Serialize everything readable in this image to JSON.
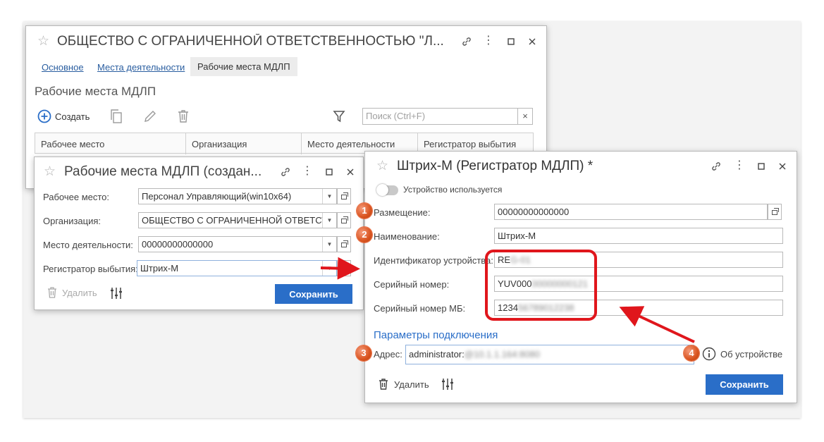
{
  "main_window": {
    "title": "ОБЩЕСТВО С ОГРАНИЧЕННОЙ ОТВЕТСТВЕННОСТЬЮ \"Л...",
    "tabs": [
      {
        "label": "Основное",
        "active": false
      },
      {
        "label": "Места деятельности",
        "active": false
      },
      {
        "label": "Рабочие места МДЛП",
        "active": true
      }
    ],
    "section_title": "Рабочие места МДЛП",
    "toolbar": {
      "create_label": "Создать",
      "search_placeholder": "Поиск (Ctrl+F)",
      "search_clear": "×"
    },
    "columns": [
      "Рабочее место",
      "Организация",
      "Место деятельности",
      "Регистратор выбытия"
    ]
  },
  "workplace_dialog": {
    "title": "Рабочие места МДЛП (создан...",
    "fields": [
      {
        "label": "Рабочее место:",
        "value": "Персонал Управляющий(win10x64)"
      },
      {
        "label": "Организация:",
        "value": "ОБЩЕСТВО С ОГРАНИЧЕННОЙ ОТВЕТСТВЕННОСТЬЮ"
      },
      {
        "label": "Место деятельности:",
        "value": "00000000000000"
      },
      {
        "label": "Регистратор выбытия:",
        "value": "Штрих-М"
      }
    ],
    "delete_label": "Удалить",
    "save_label": "Сохранить"
  },
  "registrar_dialog": {
    "title": "Штрих-М (Регистратор МДЛП) *",
    "toggle_label": "Устройство используется",
    "fields": [
      {
        "label": "Размещение:",
        "value": "00000000000000"
      },
      {
        "label": "Наименование:",
        "value": "Штрих-М"
      },
      {
        "label": "Идентификатор устройства:",
        "value_visible": "RE",
        "value_blurred": "G-01"
      },
      {
        "label": "Серийный номер:",
        "value_visible": "YUV000",
        "value_blurred": "00000000121"
      },
      {
        "label": "Серийный номер МБ:",
        "value_visible": "1234",
        "value_blurred": "56789012238"
      }
    ],
    "connection_section": "Параметры подключения",
    "address_label": "Адрес:",
    "address_visible": "administrator:",
    "address_blurred": "@10.1.1.164:8080",
    "about_label": "Об устройстве",
    "delete_label": "Удалить",
    "save_label": "Сохранить"
  },
  "badges": [
    "1",
    "2",
    "3",
    "4"
  ],
  "colors": {
    "accent": "#2a6ec8",
    "annotation_red": "#e0161c",
    "badge_orange": "#d9531e"
  }
}
